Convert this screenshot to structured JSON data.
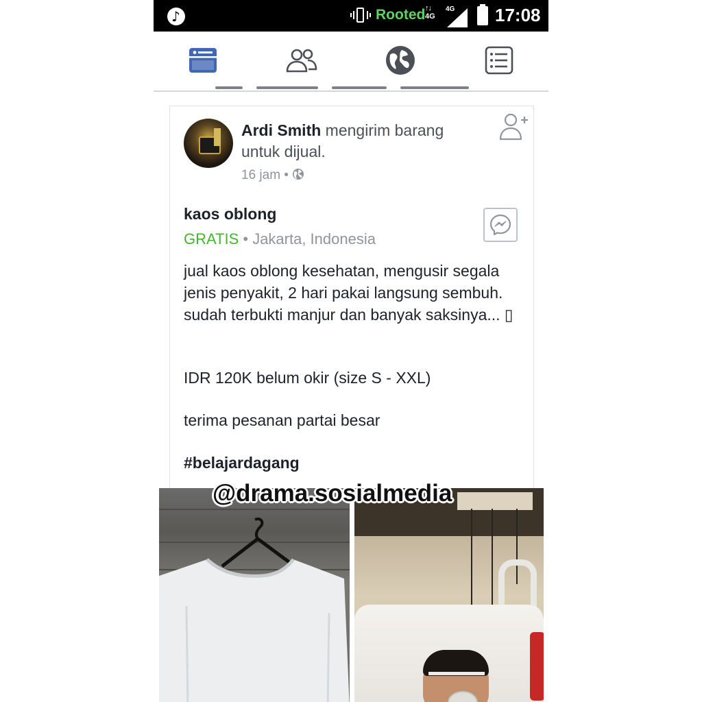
{
  "status_bar": {
    "rooted_label": "Rooted",
    "network_top": "↑↓",
    "network_bottom": "4G",
    "signal_label": "4G",
    "time": "17:08",
    "icons": [
      "music-notification-icon",
      "vibrate-icon",
      "signal-icon",
      "battery-icon"
    ]
  },
  "nav_tabs": [
    {
      "name": "news-feed",
      "icon": "news-feed-icon",
      "active": true
    },
    {
      "name": "friend-requests",
      "icon": "friends-icon",
      "active": false
    },
    {
      "name": "notifications",
      "icon": "globe-icon",
      "active": false
    },
    {
      "name": "menu",
      "icon": "menu-list-icon",
      "active": false
    }
  ],
  "post": {
    "author": "Ardi Smith",
    "action": " mengirim barang untuk dijual.",
    "time": "16 jam",
    "separator": " • ",
    "item_title": "kaos oblong",
    "price": "GRATIS",
    "location": " • Jakarta, Indonesia",
    "description": "jual kaos oblong kesehatan, mengusir segala jenis penyakit, 2 hari pakai langsung sembuh. sudah terbukti manjur dan banyak saksinya... ▯",
    "price_line": "IDR 120K belum okir (size S - XXL)",
    "order_line": "terima pesanan partai besar",
    "hashtag": "#belajardagang"
  },
  "watermark": "@drama.sosialmedia",
  "colors": {
    "facebook_blue": "#4267b2",
    "price_green": "#42b72a",
    "rooted_green": "#5fd35f",
    "meta_gray": "#90949c"
  }
}
